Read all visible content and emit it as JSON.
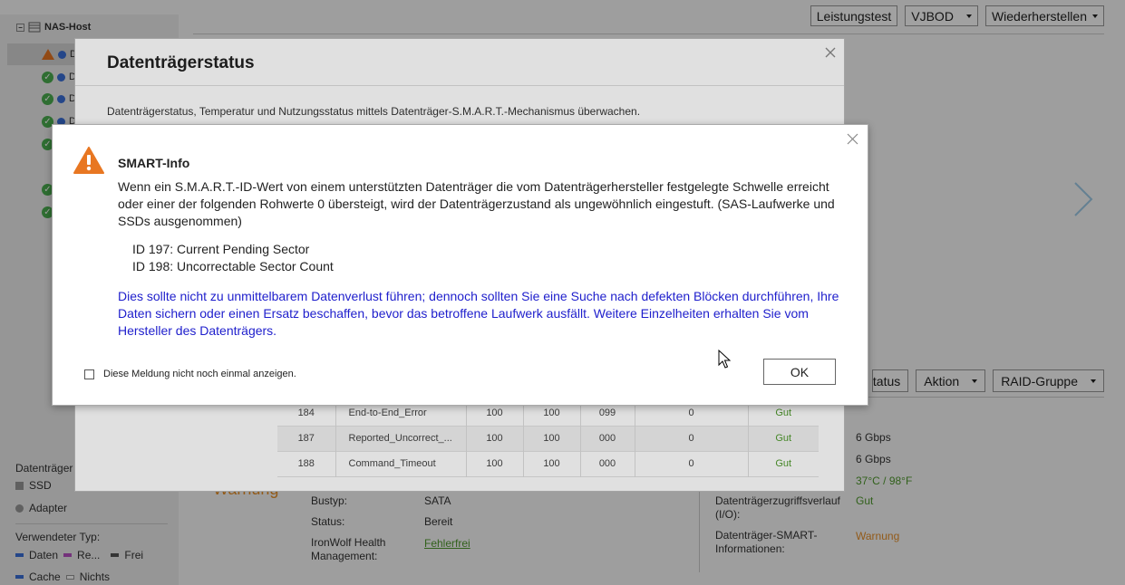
{
  "background": {
    "tree": {
      "root_label": "NAS-Host",
      "items": [
        {
          "status": "warning",
          "label": "D"
        },
        {
          "status": "ok",
          "label": "D"
        },
        {
          "status": "ok",
          "label": "D"
        },
        {
          "status": "ok",
          "label": "D"
        },
        {
          "status": "ok",
          "label": ""
        },
        {
          "status": "ok",
          "label": ""
        },
        {
          "status": "ok",
          "label": ""
        }
      ]
    },
    "legend": {
      "type_title": "Datenträger",
      "ssd": "SSD",
      "adapter": "Adapter",
      "used_title": "Verwendeter Typ:",
      "data": "Daten",
      "re": "Re...",
      "free": "Frei",
      "cache": "Cache",
      "none": "Nichts"
    },
    "toolbar": {
      "perf_test": "Leistungstest",
      "vjbod": "VJBOD",
      "restore": "Wiederherstellen"
    },
    "mid_toolbar": {
      "status": "tatus",
      "action": "Aktion",
      "raid": "RAID-Gruppe"
    },
    "details_left": {
      "warning_text": "Warnung",
      "bus_label": "Bustyp:",
      "bus_value": "SATA",
      "status_label": "Status:",
      "status_value": "Bereit",
      "ihm_label": "IronWolf Health Management:",
      "ihm_value": "Fehlerfrei"
    },
    "details_right": {
      "speed1": "6 Gbps",
      "speed2": "6 Gbps",
      "temp": "37°C / 98°F",
      "io_label": "Datenträgerzugriffsverlauf (I/O):",
      "io_value": "Gut",
      "smart_label": "Datenträger-SMART-Informationen:",
      "smart_value": "Warnung"
    }
  },
  "parent_modal": {
    "title": "Datenträgerstatus",
    "description": "Datenträgerstatus, Temperatur und Nutzungsstatus mittels Datenträger-S.M.A.R.T.-Mechanismus überwachen.",
    "table_rows": [
      [
        "184",
        "End-to-End_Error",
        "100",
        "100",
        "099",
        "0",
        "Gut"
      ],
      [
        "187",
        "Reported_Uncorrect_...",
        "100",
        "100",
        "000",
        "0",
        "Gut"
      ],
      [
        "188",
        "Command_Timeout",
        "100",
        "100",
        "000",
        "0",
        "Gut"
      ]
    ]
  },
  "dialog": {
    "title": "SMART-Info",
    "body": "Wenn ein S.M.A.R.T.-ID-Wert von einem unterstützten Datenträger die vom Datenträgerhersteller festgelegte Schwelle erreicht oder einer der folgenden Rohwerte 0 übersteigt, wird der Datenträgerzustand als ungewöhnlich eingestuft. (SAS-Laufwerke und SSDs ausgenommen)",
    "id1": "ID 197: Current Pending Sector",
    "id2": "ID 198: Uncorrectable Sector Count",
    "note": "Dies sollte nicht zu unmittelbarem Datenverlust führen; dennoch sollten Sie eine Suche nach defekten Blöcken durchführen, Ihre Daten sichern oder einen Ersatz beschaffen, bevor das betroffene Laufwerk ausfällt. Weitere Einzelheiten erhalten Sie vom Hersteller des Datenträgers.",
    "checkbox_label": "Diese Meldung nicht noch einmal anzeigen.",
    "ok_label": "OK"
  },
  "colors": {
    "warning": "#e87722",
    "ok": "#4caf50",
    "note_text": "#1e1ecc"
  },
  "icons": [
    "warning-icon",
    "check-icon",
    "close-icon",
    "chevron-right-icon",
    "mouse-cursor-icon"
  ]
}
